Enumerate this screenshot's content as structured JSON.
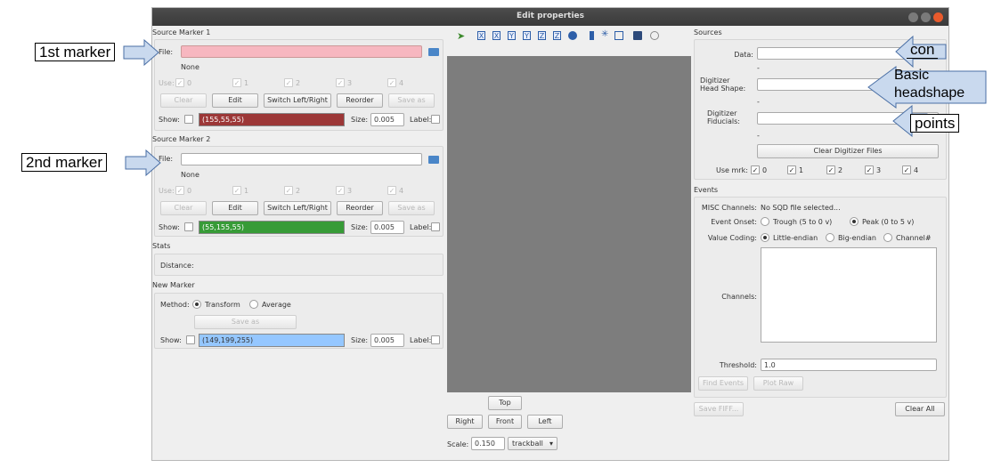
{
  "window": {
    "title": "Edit properties"
  },
  "marker1": {
    "header": "Source Marker 1",
    "file_label": "File:",
    "file_value": "",
    "none": "None",
    "use_label": "Use:",
    "use": [
      "0",
      "1",
      "2",
      "3",
      "4"
    ],
    "buttons": {
      "clear": "Clear",
      "edit": "Edit",
      "switch": "Switch Left/Right",
      "reorder": "Reorder",
      "save_as": "Save as"
    },
    "show_label": "Show:",
    "color_value": "(155,55,55)",
    "color": "#9c3737",
    "size_label": "Size:",
    "size_value": "0.005",
    "label_label": "Label:"
  },
  "marker2": {
    "header": "Source Marker 2",
    "file_label": "File:",
    "file_value": "",
    "none": "None",
    "use_label": "Use:",
    "use": [
      "0",
      "1",
      "2",
      "3",
      "4"
    ],
    "buttons": {
      "clear": "Clear",
      "edit": "Edit",
      "switch": "Switch Left/Right",
      "reorder": "Reorder",
      "save_as": "Save as"
    },
    "show_label": "Show:",
    "color_value": "(55,155,55)",
    "color": "#379b37",
    "size_label": "Size:",
    "size_value": "0.005",
    "label_label": "Label:"
  },
  "stats": {
    "header": "Stats",
    "distance_label": "Distance:"
  },
  "new_marker": {
    "header": "New Marker",
    "method_label": "Method:",
    "transform": "Transform",
    "average": "Average",
    "save_as": "Save as",
    "show_label": "Show:",
    "color_value": "(149,199,255)",
    "color": "#95c7ff",
    "size_label": "Size:",
    "size_value": "0.005",
    "label_label": "Label:"
  },
  "view": {
    "toolbar_icons": [
      "X",
      "X",
      "Y",
      "Y",
      "Z",
      "Z"
    ],
    "top": "Top",
    "right": "Right",
    "front": "Front",
    "left": "Left",
    "scale_label": "Scale:",
    "scale_value": "0.150",
    "mode": "trackball"
  },
  "sources": {
    "header": "Sources",
    "data_label": "Data:",
    "dash1": "-",
    "head_shape_label_1": "Digitizer",
    "head_shape_label_2": "Head Shape:",
    "dash2": "-",
    "fiducials_label_1": "Digitizer",
    "fiducials_label_2": "Fiducials:",
    "dash3": "-",
    "clear_digitizer": "Clear Digitizer Files",
    "use_mrk_label": "Use mrk:",
    "use_mrk": [
      "0",
      "1",
      "2",
      "3",
      "4"
    ]
  },
  "events": {
    "header": "Events",
    "misc_label": "MISC Channels:",
    "misc_value": "No SQD file selected...",
    "onset_label": "Event Onset:",
    "trough": "Trough (5 to 0 v)",
    "peak": "Peak (0 to 5 v)",
    "coding_label": "Value Coding:",
    "little": "Little-endian",
    "big": "Big-endian",
    "channel": "Channel#",
    "channels_label": "Channels:",
    "threshold_label": "Threshold:",
    "threshold_value": "1.0",
    "find_events": "Find Events",
    "plot_raw": "Plot Raw"
  },
  "footer": {
    "save_fiff": "Save FIFF...",
    "clear_all": "Clear All"
  },
  "annotations": {
    "first_marker": "1st marker",
    "second_marker": "2nd marker",
    "con": "con",
    "basic_1": "Basic",
    "basic_2": "headshape",
    "points": "points"
  },
  "colors": {
    "arrow_fill": "#c9d9ee",
    "arrow_stroke": "#4a6fa5"
  }
}
